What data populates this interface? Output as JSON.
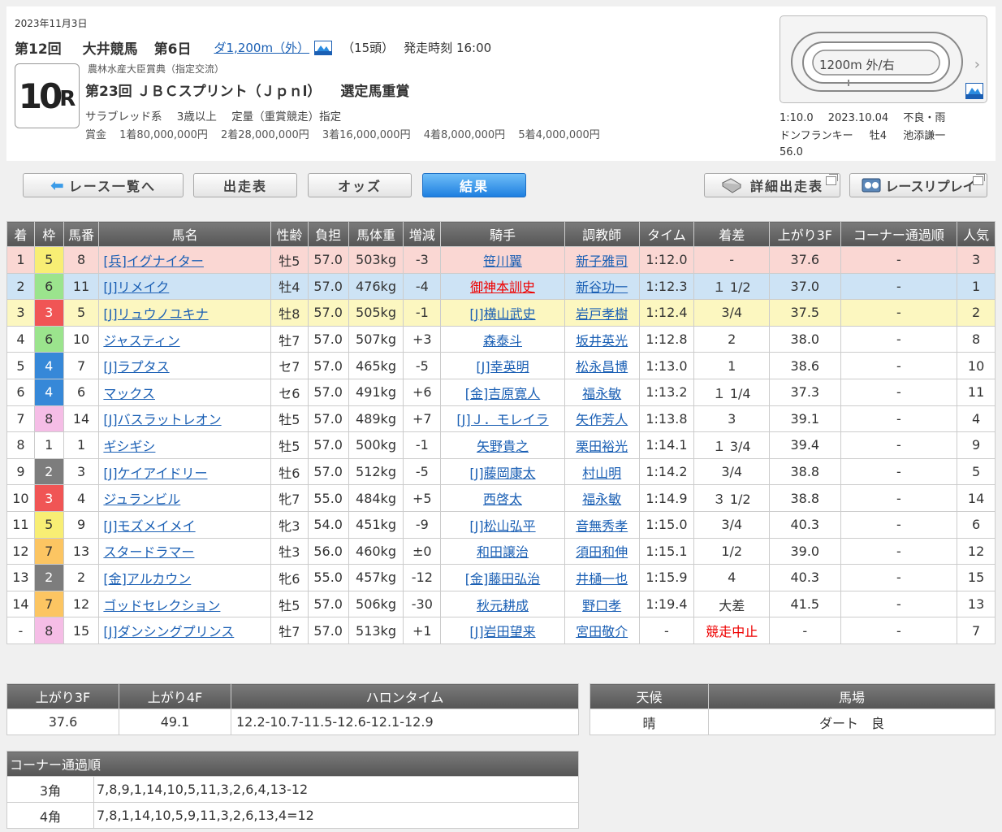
{
  "header": {
    "date": "2023年11月3日",
    "race_no": "第12回",
    "venue": "大井競馬",
    "day": "第6日",
    "course": "ダ1,200m（外）",
    "runners": "（15頭）",
    "start_time": "発走時刻 16:00",
    "race_badge_num": "10",
    "race_badge_r": "R",
    "subtitle": "農林水産大臣賞典（指定交流）",
    "race_name": "第23回 ＪＢＣスプリント（Ｊｐｎl）",
    "grade": "選定馬重賞",
    "conditions": [
      "サラブレッド系",
      "3歳以上",
      "定量（重賞競走）指定"
    ],
    "prize_label": "賞金",
    "prizes": [
      "1着80,000,000円",
      "2着28,000,000円",
      "3着16,000,000円",
      "4着8,000,000円",
      "5着4,000,000円"
    ],
    "track_label": "1200m 外/右",
    "track_chevron": "›",
    "record_time": "1:10.0",
    "record_date": "2023.10.04",
    "record_cond": "不良・雨",
    "record_horse": "ドンフランキー",
    "record_sexage": "牡4",
    "record_jockey": "池添謙一",
    "record_weight": "56.0"
  },
  "tabs": {
    "list": "レース一覧へ",
    "entries": "出走表",
    "odds": "オッズ",
    "result": "結果",
    "detail": "詳細出走表",
    "replay": "レースリプレイ"
  },
  "results": {
    "columns": [
      "着",
      "枠",
      "馬番",
      "馬名",
      "性齢",
      "負担",
      "馬体重",
      "増減",
      "騎手",
      "調教師",
      "タイム",
      "着差",
      "上がり3F",
      "コーナー通過順",
      "人気"
    ],
    "rows": [
      {
        "pos": "1",
        "waku": "5",
        "num": "8",
        "name": "[兵]イグナイター",
        "sexage": "牡5",
        "wt": "57.0",
        "bw": "503kg",
        "diff": "-3",
        "jockey": "笹川翼",
        "trainer": "新子雅司",
        "time": "1:12.0",
        "margin": "-",
        "f3": "37.6",
        "corner": "-",
        "pop": "3"
      },
      {
        "pos": "2",
        "waku": "6",
        "num": "11",
        "name": "[J]リメイク",
        "sexage": "牡4",
        "wt": "57.0",
        "bw": "476kg",
        "diff": "-4",
        "jockey": "御神本訓史",
        "trainer": "新谷功一",
        "time": "1:12.3",
        "margin": "１ 1/2",
        "f3": "37.0",
        "corner": "-",
        "pop": "1"
      },
      {
        "pos": "3",
        "waku": "3",
        "num": "5",
        "name": "[J]リュウノユキナ",
        "sexage": "牡8",
        "wt": "57.0",
        "bw": "505kg",
        "diff": "-1",
        "jockey": "[J]横山武史",
        "trainer": "岩戸孝樹",
        "time": "1:12.4",
        "margin": "3/4",
        "f3": "37.5",
        "corner": "-",
        "pop": "2"
      },
      {
        "pos": "4",
        "waku": "6",
        "num": "10",
        "name": "ジャスティン",
        "sexage": "牡7",
        "wt": "57.0",
        "bw": "507kg",
        "diff": "+3",
        "jockey": "森泰斗",
        "trainer": "坂井英光",
        "time": "1:12.8",
        "margin": "2",
        "f3": "38.0",
        "corner": "-",
        "pop": "8"
      },
      {
        "pos": "5",
        "waku": "4",
        "num": "7",
        "name": "[J]ラプタス",
        "sexage": "セ7",
        "wt": "57.0",
        "bw": "465kg",
        "diff": "-5",
        "jockey": "[J]幸英明",
        "trainer": "松永昌博",
        "time": "1:13.0",
        "margin": "1",
        "f3": "38.6",
        "corner": "-",
        "pop": "10"
      },
      {
        "pos": "6",
        "waku": "4",
        "num": "6",
        "name": "マックス",
        "sexage": "セ6",
        "wt": "57.0",
        "bw": "491kg",
        "diff": "+6",
        "jockey": "[金]吉原寛人",
        "trainer": "福永敏",
        "time": "1:13.2",
        "margin": "１ 1/4",
        "f3": "37.3",
        "corner": "-",
        "pop": "11"
      },
      {
        "pos": "7",
        "waku": "8",
        "num": "14",
        "name": "[J]バスラットレオン",
        "sexage": "牡5",
        "wt": "57.0",
        "bw": "489kg",
        "diff": "+7",
        "jockey": "[J]Ｊ．モレイラ",
        "trainer": "矢作芳人",
        "time": "1:13.8",
        "margin": "3",
        "f3": "39.1",
        "corner": "-",
        "pop": "4"
      },
      {
        "pos": "8",
        "waku": "1",
        "num": "1",
        "name": "ギシギシ",
        "sexage": "牡5",
        "wt": "57.0",
        "bw": "500kg",
        "diff": "-1",
        "jockey": "矢野貴之",
        "trainer": "栗田裕光",
        "time": "1:14.1",
        "margin": "１ 3/4",
        "f3": "39.4",
        "corner": "-",
        "pop": "9"
      },
      {
        "pos": "9",
        "waku": "2",
        "num": "3",
        "name": "[J]ケイアイドリー",
        "sexage": "牡6",
        "wt": "57.0",
        "bw": "512kg",
        "diff": "-5",
        "jockey": "[J]藤岡康太",
        "trainer": "村山明",
        "time": "1:14.2",
        "margin": "3/4",
        "f3": "38.8",
        "corner": "-",
        "pop": "5"
      },
      {
        "pos": "10",
        "waku": "3",
        "num": "4",
        "name": "ジュランビル",
        "sexage": "牝7",
        "wt": "55.0",
        "bw": "484kg",
        "diff": "+5",
        "jockey": "西啓太",
        "trainer": "福永敏",
        "time": "1:14.9",
        "margin": "３ 1/2",
        "f3": "38.8",
        "corner": "-",
        "pop": "14"
      },
      {
        "pos": "11",
        "waku": "5",
        "num": "9",
        "name": "[J]モズメイメイ",
        "sexage": "牝3",
        "wt": "54.0",
        "bw": "451kg",
        "diff": "-9",
        "jockey": "[J]松山弘平",
        "trainer": "音無秀孝",
        "time": "1:15.0",
        "margin": "3/4",
        "f3": "40.3",
        "corner": "-",
        "pop": "6"
      },
      {
        "pos": "12",
        "waku": "7",
        "num": "13",
        "name": "スタードラマー",
        "sexage": "牡3",
        "wt": "56.0",
        "bw": "460kg",
        "diff": "±0",
        "jockey": "和田譲治",
        "trainer": "須田和伸",
        "time": "1:15.1",
        "margin": "1/2",
        "f3": "39.0",
        "corner": "-",
        "pop": "12"
      },
      {
        "pos": "13",
        "waku": "2",
        "num": "2",
        "name": "[金]アルカウン",
        "sexage": "牝6",
        "wt": "55.0",
        "bw": "457kg",
        "diff": "-12",
        "jockey": "[金]藤田弘治",
        "trainer": "井樋一也",
        "time": "1:15.9",
        "margin": "4",
        "f3": "40.3",
        "corner": "-",
        "pop": "15"
      },
      {
        "pos": "14",
        "waku": "7",
        "num": "12",
        "name": "ゴッドセレクション",
        "sexage": "牡5",
        "wt": "57.0",
        "bw": "506kg",
        "diff": "-30",
        "jockey": "秋元耕成",
        "trainer": "野口孝",
        "time": "1:19.4",
        "margin": "大差",
        "f3": "41.5",
        "corner": "-",
        "pop": "13"
      },
      {
        "pos": "-",
        "waku": "8",
        "num": "15",
        "name": "[J]ダンシングプリンス",
        "sexage": "牡7",
        "wt": "57.0",
        "bw": "513kg",
        "diff": "+1",
        "jockey": "[J]岩田望来",
        "trainer": "宮田敬介",
        "time": "-",
        "margin": "競走中止",
        "f3": "-",
        "corner": "-",
        "pop": "7"
      }
    ]
  },
  "summary": {
    "col_f3": "上がり3F",
    "col_f4": "上がり4F",
    "col_lap": "ハロンタイム",
    "f3": "37.6",
    "f4": "49.1",
    "lap": "12.2-10.7-11.5-12.6-12.1-12.9"
  },
  "weather": {
    "col_weather": "天候",
    "col_track": "馬場",
    "weather": "晴",
    "track": "ダート　良"
  },
  "corner": {
    "title": "コーナー通過順",
    "rows": [
      {
        "label": "3角",
        "value": "7,8,9,1,14,10,5,11,3,2,6,4,13-12"
      },
      {
        "label": "4角",
        "value": "7,8,1,14,10,5,9,11,3,2,6,13,4=12"
      }
    ]
  },
  "colors": {
    "link": "#1a5fb4",
    "header_bg": "#666666",
    "active_tab": "#1e7fe0",
    "row1": "#fad7d3",
    "row2": "#cde3f5",
    "row3": "#fcf7c0",
    "red_text": "#ee0000"
  }
}
